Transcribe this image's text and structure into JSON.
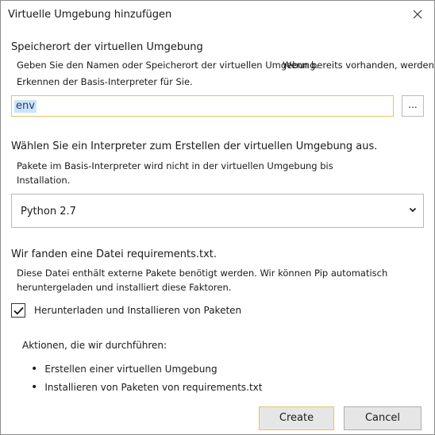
{
  "window": {
    "title": "Virtuelle Umgebung hinzufügen",
    "close_icon": "close-icon"
  },
  "location": {
    "heading": "Speicherort der virtuellen Umgebung",
    "desc_line1_a": "Geben Sie den Namen oder Speicherort der virtuellen Umgebung.",
    "desc_line1_b": "Wenn bereits vorhanden, werden wir",
    "desc_line2": "Erkennen der Basis-Interpreter für Sie.",
    "value": "env",
    "browse_label": "..."
  },
  "interpreter": {
    "heading": "Wählen Sie ein Interpreter zum Erstellen der virtuellen Umgebung aus.",
    "desc_line1": "Pakete im Basis-Interpreter wird nicht in der virtuellen Umgebung bis",
    "desc_line2": "Installation.",
    "selected": "Python 2.7"
  },
  "requirements": {
    "heading": "Wir fanden eine Datei requirements.txt.",
    "desc_line1": "Diese Datei enthält externe Pakete benötigt werden. Wir können Pip automatisch",
    "desc_line2": "heruntergeladen und installiert diese Faktoren.",
    "checkbox_label": "Herunterladen und Installieren von Paketen",
    "checkbox_checked": true
  },
  "actions": {
    "heading": "Aktionen, die wir durchführen:",
    "items": [
      "Erstellen einer virtuellen Umgebung",
      "Installieren von Paketen von requirements.txt"
    ]
  },
  "buttons": {
    "create_label": "Create",
    "cancel_label": "Cancel"
  },
  "colors": {
    "focus_border": "#e5c36a",
    "selection_bg": "#cce4f7",
    "button_bg": "#e6e6e6"
  }
}
